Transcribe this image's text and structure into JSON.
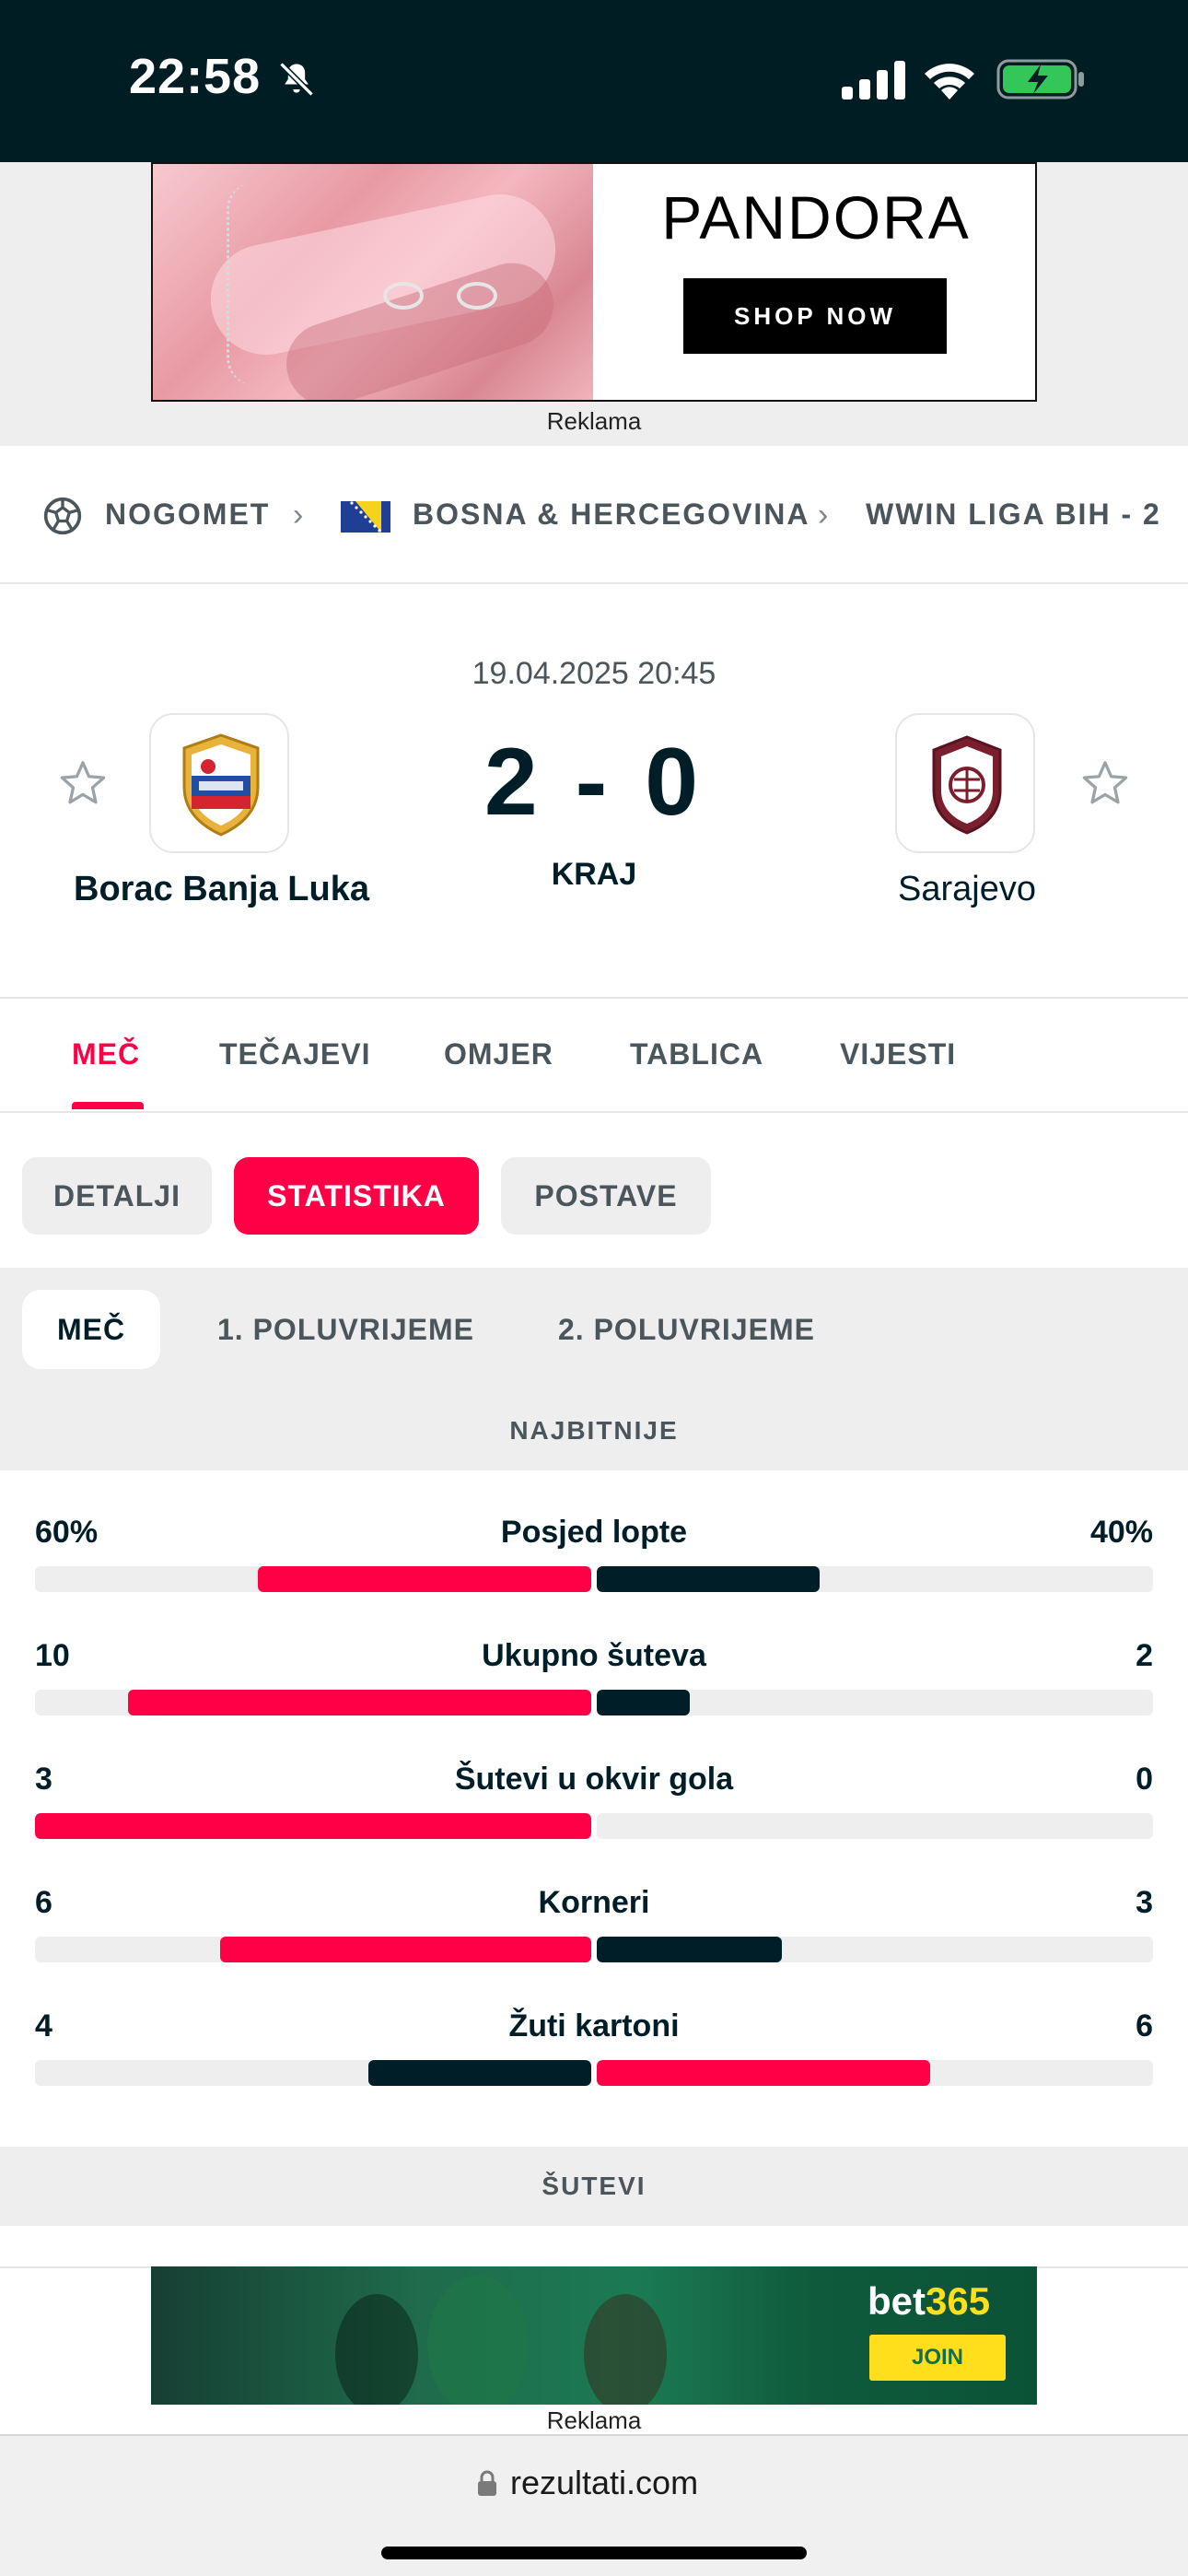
{
  "status_bar": {
    "time": "22:58",
    "icons": [
      "bell-slash-icon",
      "signal-icon",
      "wifi-icon",
      "battery-charging-icon"
    ]
  },
  "top_ad": {
    "brand": "PANDORA",
    "cta": "SHOP NOW",
    "caption": "Reklama"
  },
  "breadcrumb": {
    "sport": "NOGOMET",
    "country": "BOSNA & HERCEGOVINA",
    "league": "WWIN LIGA BIH - 2"
  },
  "match": {
    "datetime": "19.04.2025 20:45",
    "home_team": "Borac Banja Luka",
    "away_team": "Sarajevo",
    "home_score": "2",
    "separator": "-",
    "away_score": "0",
    "status": "KRAJ"
  },
  "main_tabs": [
    "MEČ",
    "TEČAJEVI",
    "OMJER",
    "TABLICA",
    "VIJESTI"
  ],
  "main_tab_active": "MEČ",
  "sub_tabs": [
    "DETALJI",
    "STATISTIKA",
    "POSTAVE"
  ],
  "sub_tab_active": "STATISTIKA",
  "periods": [
    "MEČ",
    "1. POLUVRIJEME",
    "2. POLUVRIJEME"
  ],
  "period_active": "MEČ",
  "sections": {
    "highlights": "NAJBITNIJE",
    "shots": "ŠUTEVI"
  },
  "stats": [
    {
      "name": "Posjed lopte",
      "home": "60%",
      "away": "40%",
      "home_share": 0.6,
      "away_share": 0.4,
      "leader": "home"
    },
    {
      "name": "Ukupno šuteva",
      "home": "10",
      "away": "2",
      "home_share": 0.8333,
      "away_share": 0.1667,
      "leader": "home"
    },
    {
      "name": "Šutevi u okvir gola",
      "home": "3",
      "away": "0",
      "home_share": 1.0,
      "away_share": 0.0,
      "leader": "home"
    },
    {
      "name": "Korneri",
      "home": "6",
      "away": "3",
      "home_share": 0.6667,
      "away_share": 0.3333,
      "leader": "home"
    },
    {
      "name": "Žuti kartoni",
      "home": "4",
      "away": "6",
      "home_share": 0.4,
      "away_share": 0.6,
      "leader": "away"
    }
  ],
  "colors": {
    "accent": "#ff0046",
    "dark": "#001e28",
    "muted": "#4b555c",
    "track": "#eeeeee"
  },
  "bottom_ad": {
    "brand_a": "bet",
    "brand_b": "365",
    "cta": "JOIN",
    "caption": "Reklama"
  },
  "browser": {
    "url": "rezultati.com"
  }
}
